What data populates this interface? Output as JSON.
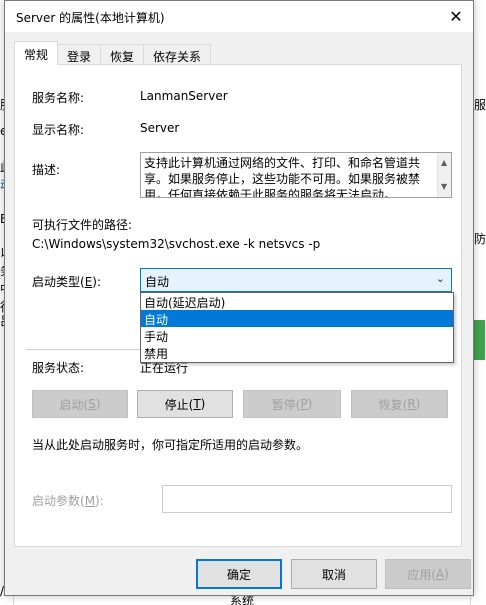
{
  "background": {
    "left_fragments": [
      "服",
      "e",
      "此",
      "动",
      "E",
      "以",
      "务",
      "中",
      "行",
      "吕",
      "/"
    ],
    "right_fragments": [
      "服",
      "防"
    ],
    "bottom_text": "系统"
  },
  "dialog": {
    "title": "Server 的属性(本地计算机)",
    "close_glyph": "✕",
    "tabs": [
      {
        "label": "常规",
        "active": true
      },
      {
        "label": "登录",
        "active": false
      },
      {
        "label": "恢复",
        "active": false
      },
      {
        "label": "依存关系",
        "active": false
      }
    ],
    "service_name_label": "服务名称:",
    "service_name": "LanmanServer",
    "display_name_label": "显示名称:",
    "display_name": "Server",
    "description_label": "描述:",
    "description": "支持此计算机通过网络的文件、打印、和命名管道共享。如果服务停止，这些功能不可用。如果服务被禁用，任何直接依赖于此服务的服务将无法启动。",
    "exe_path_label": "可执行文件的路径:",
    "exe_path": "C:\\Windows\\system32\\svchost.exe -k netsvcs -p",
    "startup_type_label": "启动类型(",
    "startup_type_accel": "E",
    "startup_type_suffix": "):",
    "startup_type_value": "自动",
    "startup_options": [
      "自动(延迟启动)",
      "自动",
      "手动",
      "禁用"
    ],
    "startup_selected_index": 1,
    "service_status_label": "服务状态:",
    "service_status": "正在运行",
    "buttons": {
      "start": {
        "label": "启动(",
        "accel": "S",
        "suffix": ")",
        "enabled": false
      },
      "stop": {
        "label": "停止(",
        "accel": "T",
        "suffix": ")",
        "enabled": true
      },
      "pause": {
        "label": "暂停(",
        "accel": "P",
        "suffix": ")",
        "enabled": false
      },
      "resume": {
        "label": "恢复(",
        "accel": "R",
        "suffix": ")",
        "enabled": false
      }
    },
    "hint": "当从此处启动服务时，你可指定所适用的启动参数。",
    "start_params_label": "启动参数(",
    "start_params_accel": "M",
    "start_params_suffix": "):",
    "start_params_value": "",
    "ok_label": "确定",
    "cancel_label": "取消",
    "apply_label": "应用(",
    "apply_accel": "A",
    "apply_suffix": ")"
  }
}
